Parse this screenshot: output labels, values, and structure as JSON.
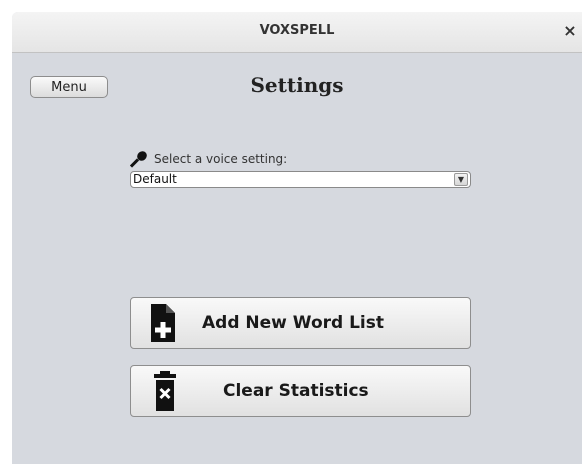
{
  "window": {
    "title": "VOXSPELL",
    "close_label": "×"
  },
  "header": {
    "menu_label": "Menu",
    "page_title": "Settings"
  },
  "voice": {
    "label": "Select a voice setting:",
    "selected": "Default",
    "icon": "microphone-icon",
    "arrow": "▼"
  },
  "actions": {
    "add_word_list_label": "Add New Word List",
    "add_icon": "file-plus-icon",
    "clear_stats_label": "Clear Statistics",
    "clear_icon": "trash-icon"
  }
}
